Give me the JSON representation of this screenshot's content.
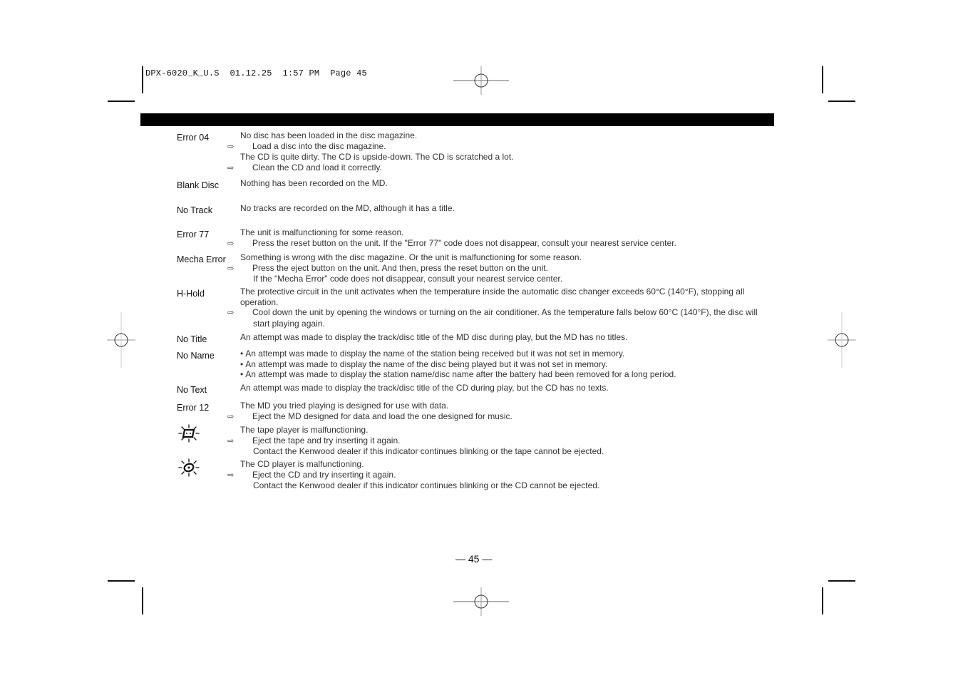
{
  "slug": {
    "model": "DPX-6020_K_U.S",
    "date": "01.12.25",
    "time": "1:57 PM",
    "page_label": "Page 45"
  },
  "entries": [
    {
      "term": "Error 04",
      "lines": [
        {
          "type": "text",
          "text": "No disc has been loaded in the disc magazine."
        },
        {
          "type": "action",
          "text": "Load a disc into the disc magazine."
        },
        {
          "type": "text",
          "text": "The CD is quite dirty. The CD is upside-down. The CD is scratched a lot."
        },
        {
          "type": "action",
          "text": "Clean the CD and load it correctly."
        }
      ]
    },
    {
      "term": "Blank Disc",
      "lines": [
        {
          "type": "text",
          "text": "Nothing has been recorded on the MD."
        }
      ]
    },
    {
      "term": "No Track",
      "lines": [
        {
          "type": "text",
          "text": "No tracks are recorded on the MD, although it has a title."
        }
      ]
    },
    {
      "term": "Error 77",
      "lines": [
        {
          "type": "text",
          "text": "The unit is malfunctioning for some reason."
        },
        {
          "type": "action",
          "text": "Press the reset button on the unit. If the \"Error 77\" code does not disappear, consult your nearest service center."
        }
      ]
    },
    {
      "term": "Mecha Error",
      "lines": [
        {
          "type": "text",
          "text": "Something is wrong with the disc magazine. Or the unit is malfunctioning for some reason."
        },
        {
          "type": "action",
          "text": "Press the eject button on the unit. And then, press the reset button on the unit."
        },
        {
          "type": "continuation",
          "text": "If the \"Mecha Error\" code does not disappear, consult your nearest service center."
        }
      ]
    },
    {
      "term": "H-Hold",
      "lines": [
        {
          "type": "text",
          "text": "The protective circuit in the unit activates when the temperature inside the automatic disc changer exceeds 60°C (140°F), stopping all operation."
        },
        {
          "type": "action",
          "text": "Cool down the unit by opening the windows or turning on the air conditioner. As the temperature falls below 60°C (140°F), the disc will start playing again."
        }
      ]
    },
    {
      "term": "No Title",
      "lines": [
        {
          "type": "text",
          "text": "An attempt was made to display the track/disc title of the MD disc during play, but the MD has no titles."
        }
      ]
    },
    {
      "term": "No Name",
      "lines": [
        {
          "type": "bullet",
          "text": "An attempt was made to display the name of the station being received but it was not set in memory."
        },
        {
          "type": "bullet",
          "text": "An attempt was made to display the name of the disc being played but it was not set in memory."
        },
        {
          "type": "bullet",
          "text": "An attempt was made to display the station name/disc name after the battery had been removed for a long period."
        }
      ]
    },
    {
      "term": "No Text",
      "lines": [
        {
          "type": "text",
          "text": "An attempt was made to display the track/disc title of the CD during play, but the CD has no texts."
        }
      ]
    },
    {
      "term": "Error 12",
      "lines": [
        {
          "type": "text",
          "text": "The MD you tried playing is designed for use with data."
        },
        {
          "type": "action",
          "text": "Eject the MD designed for data and load the one designed for music."
        }
      ]
    },
    {
      "icon": "blinking-tape-indicator",
      "lines": [
        {
          "type": "text",
          "text": "The tape player is malfunctioning."
        },
        {
          "type": "action",
          "text": "Eject the tape and try inserting it again."
        },
        {
          "type": "continuation",
          "text": "Contact the Kenwood dealer if this indicator continues blinking or the tape cannot be ejected."
        }
      ]
    },
    {
      "icon": "blinking-cd-indicator",
      "lines": [
        {
          "type": "text",
          "text": "The CD player is malfunctioning."
        },
        {
          "type": "action",
          "text": "Eject the CD and try inserting it again."
        },
        {
          "type": "continuation",
          "text": "Contact the Kenwood dealer if this indicator continues blinking or the CD cannot be ejected."
        }
      ]
    }
  ],
  "symbols": {
    "action_arrow": "⇨",
    "bullet": "•"
  },
  "footer": {
    "page_number": "— 45 —"
  }
}
